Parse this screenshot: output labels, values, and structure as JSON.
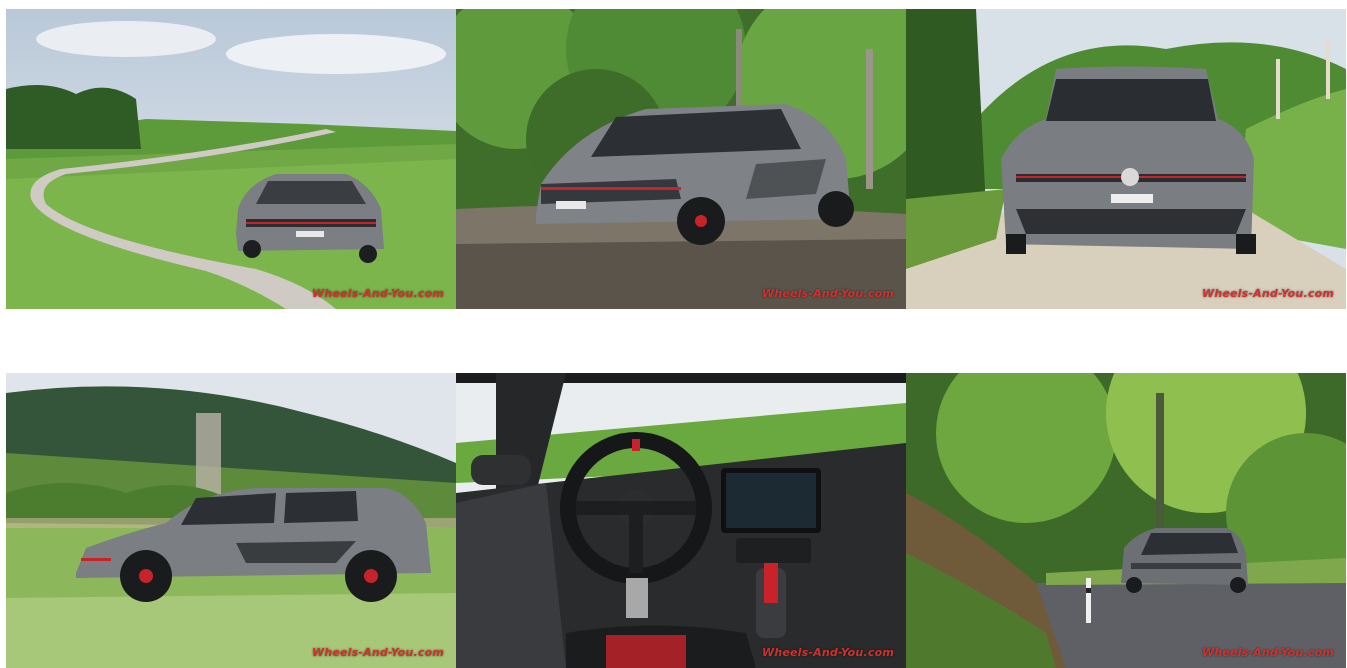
{
  "gallery": {
    "photos": [
      {
        "subject": "car-road-hills",
        "watermark": "Wheels-And-You.com"
      },
      {
        "subject": "car-forest-front",
        "watermark": "Wheels-And-You.com"
      },
      {
        "subject": "car-front-grass-path",
        "watermark": "Wheels-And-You.com"
      },
      {
        "subject": "car-side-motion",
        "watermark": "Wheels-And-You.com"
      },
      {
        "subject": "car-interior-dashboard",
        "watermark": "Wheels-And-You.com"
      },
      {
        "subject": "car-rear-forest-road",
        "watermark": "Wheels-And-You.com"
      }
    ]
  },
  "colors": {
    "watermark": "#d2312b",
    "car_body": "#7b7e83",
    "accent_red": "#c8232b"
  }
}
